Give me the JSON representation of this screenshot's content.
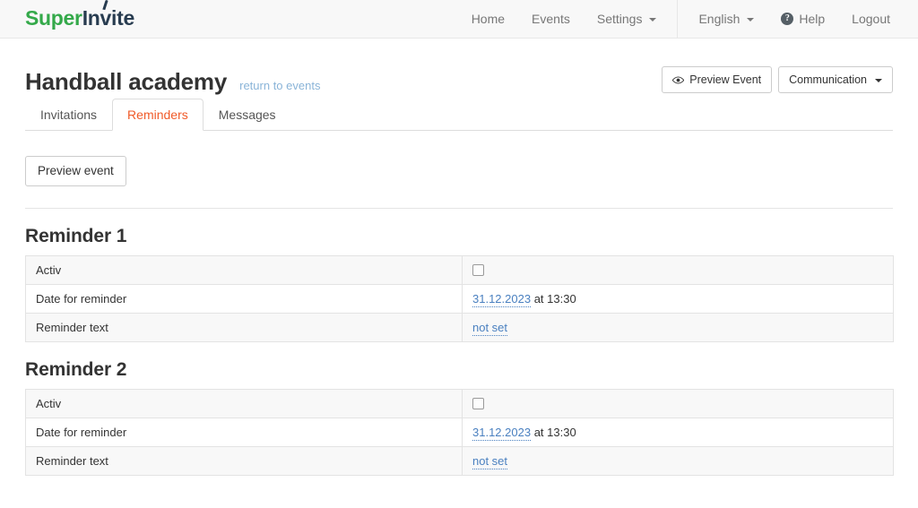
{
  "brand": {
    "part_green": "Super",
    "part_dark_a": "In",
    "part_dark_b": "ite",
    "tick_letter": "v"
  },
  "nav": {
    "primary": [
      {
        "label": "Home",
        "icon": "",
        "caret": false
      },
      {
        "label": "Events",
        "icon": "",
        "caret": false
      },
      {
        "label": "Settings",
        "icon": "",
        "caret": true
      }
    ],
    "secondary": [
      {
        "label": "English",
        "icon": "",
        "caret": true
      },
      {
        "label": "Help",
        "icon": "question-circle-icon",
        "caret": false
      },
      {
        "label": "Logout",
        "icon": "",
        "caret": false
      }
    ],
    "help_glyph": "?"
  },
  "page": {
    "title": "Handball academy",
    "return_link": "return to events"
  },
  "head_actions": {
    "preview_event": "Preview Event",
    "preview_event_icon": "eye-icon",
    "communication": "Communication"
  },
  "tabs": [
    {
      "label": "Invitations",
      "active": false
    },
    {
      "label": "Reminders",
      "active": true
    },
    {
      "label": "Messages",
      "active": false
    }
  ],
  "toolbar": {
    "preview_event_button": "Preview event"
  },
  "sections": [
    {
      "title": "Reminder 1",
      "rows": [
        {
          "label": "Activ",
          "type": "checkbox",
          "checked": false
        },
        {
          "label": "Date for reminder",
          "type": "date",
          "link": "31.12.2023",
          "suffix": " at 13:30"
        },
        {
          "label": "Reminder text",
          "type": "link",
          "link": "not set",
          "suffix": ""
        }
      ]
    },
    {
      "title": "Reminder 2",
      "rows": [
        {
          "label": "Activ",
          "type": "checkbox",
          "checked": false
        },
        {
          "label": "Date for reminder",
          "type": "date",
          "link": "31.12.2023",
          "suffix": " at 13:30"
        },
        {
          "label": "Reminder text",
          "type": "link",
          "link": "not set",
          "suffix": ""
        }
      ]
    }
  ],
  "colors": {
    "brand_green": "#34a94a",
    "brand_dark": "#283c50",
    "active_tab": "#f05a28",
    "link_blue": "#4a80c0",
    "return_link_blue": "#8ab4d8",
    "navbar_bg": "#f8f8f8",
    "row_stripe": "#f8f8f8",
    "border": "#e3e3e3"
  }
}
